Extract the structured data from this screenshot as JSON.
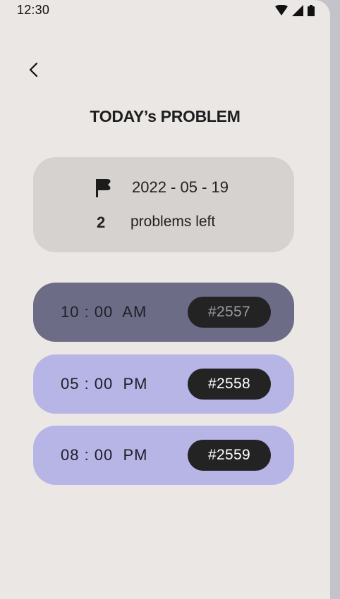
{
  "status_bar": {
    "time": "12:30",
    "icons": [
      "wifi-icon",
      "cellular-signal-icon",
      "battery-icon"
    ]
  },
  "header": {
    "back_icon": "chevron-left-icon",
    "title": "TODAY’s PROBLEM"
  },
  "summary": {
    "flag_icon": "flag-icon",
    "date": "2022 - 05 - 19",
    "count": "2",
    "count_label": "problems left"
  },
  "schedule": [
    {
      "time": "10 : 00  AM",
      "problem": "#2557",
      "status": "done",
      "bg": "#6d6c86",
      "text_color": "#1f1f2a",
      "badge_text": "#9a9aa6"
    },
    {
      "time": "05 : 00  PM",
      "problem": "#2558",
      "status": "pending",
      "bg": "#b7b4e6",
      "text_color": "#1e1e28",
      "badge_text": "#ffffff"
    },
    {
      "time": "08 : 00  PM",
      "problem": "#2559",
      "status": "pending",
      "bg": "#b7b4e6",
      "text_color": "#1e1e28",
      "badge_text": "#ffffff"
    }
  ],
  "colors": {
    "background": "#eae7e5",
    "summary_card": "#d5d2d0",
    "badge": "#232323",
    "side_strip": "#c3c3c9"
  }
}
